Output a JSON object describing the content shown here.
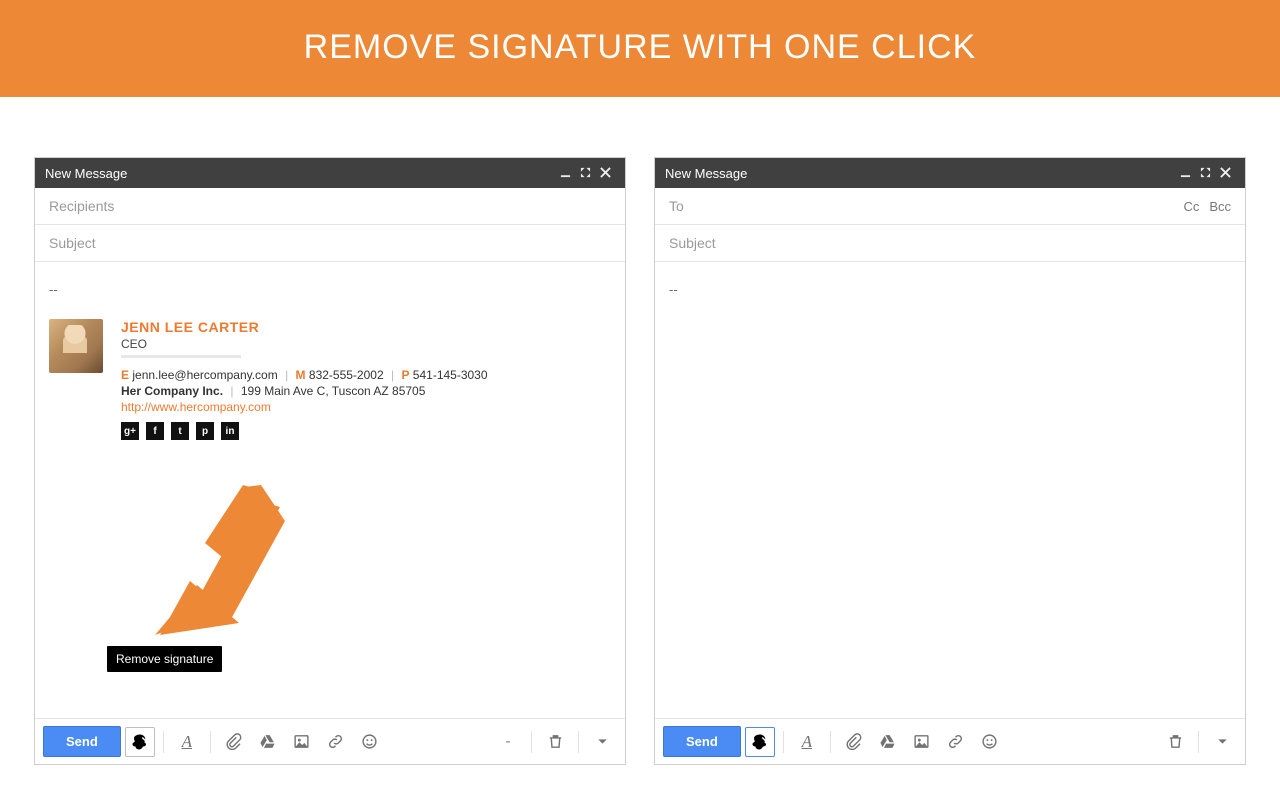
{
  "banner": {
    "title": "REMOVE SIGNATURE WITH ONE CLICK"
  },
  "left": {
    "windowTitle": "New Message",
    "recipientsPlaceholder": "Recipients",
    "subjectPlaceholder": "Subject",
    "sendLabel": "Send",
    "dash": "--",
    "tooltip": "Remove signature",
    "signature": {
      "name": "JENN LEE CARTER",
      "title": "CEO",
      "emailLabel": "E",
      "email": "jenn.lee@hercompany.com",
      "mobileLabel": "M",
      "mobile": "832-555-2002",
      "phoneLabel": "P",
      "phone": "541-145-3030",
      "company": "Her Company Inc.",
      "address": "199 Main Ave C, Tuscon AZ 85705",
      "url": "http://www.hercompany.com",
      "socials": {
        "gplus": "g+",
        "fb": "f",
        "tw": "t",
        "pin": "p",
        "li": "in"
      }
    }
  },
  "right": {
    "windowTitle": "New Message",
    "toPlaceholder": "To",
    "cc": "Cc",
    "bcc": "Bcc",
    "subjectPlaceholder": "Subject",
    "sendLabel": "Send",
    "dash": "--"
  },
  "colors": {
    "accent": "#ee7a31",
    "send": "#4b8bf4"
  }
}
